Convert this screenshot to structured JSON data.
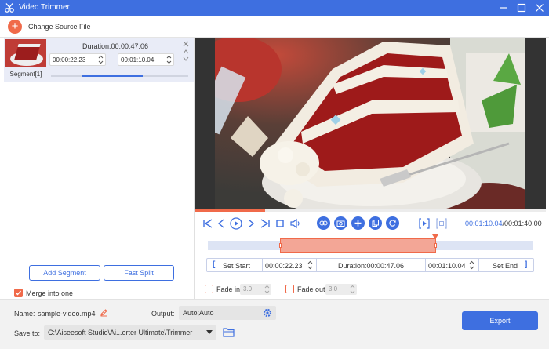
{
  "window": {
    "title": "Video Trimmer"
  },
  "toolbar": {
    "change_source": "Change Source File"
  },
  "segment": {
    "label": "Segment[1]",
    "duration": "Duration:00:00:47.06",
    "start": "00:00:22.23",
    "end": "00:01:10.04"
  },
  "left_actions": {
    "add_segment": "Add Segment",
    "fast_split": "Fast Split",
    "merge_label": "Merge into one",
    "merge_checked": true
  },
  "player": {
    "current_time": "00:01:10.04",
    "total_time": "/00:01:40.00",
    "progress_fraction": 0.2
  },
  "trim": {
    "set_start": "Set Start",
    "start": "00:00:22.23",
    "duration": "Duration:00:00:47.06",
    "end": "00:01:10.04",
    "set_end": "Set End",
    "selection_start_fraction": 0.2223,
    "selection_end_fraction": 0.7004
  },
  "fade": {
    "fade_in_label": "Fade in",
    "fade_in_value": "3.0",
    "fade_out_label": "Fade out",
    "fade_out_value": "3.0"
  },
  "output": {
    "name_label": "Name:",
    "name_value": "sample-video.mp4",
    "output_label": "Output:",
    "output_value": "Auto;Auto",
    "save_label": "Save to:",
    "save_path": "C:\\Aiseesoft Studio\\Ai...erter Ultimate\\Trimmer",
    "export": "Export"
  },
  "colors": {
    "accent": "#3e6fe0",
    "trim": "#f06a4a"
  }
}
